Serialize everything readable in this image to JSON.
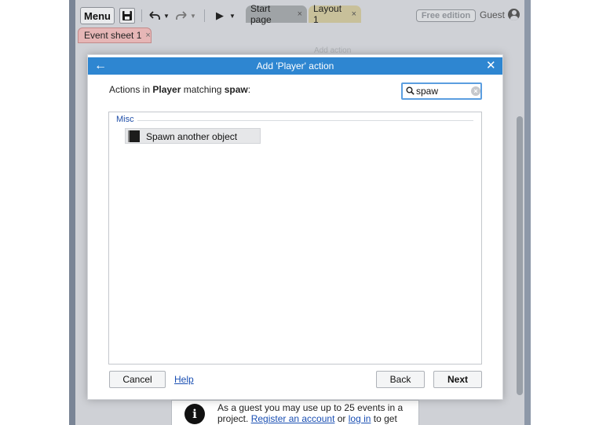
{
  "toolbar": {
    "menu_label": "Menu",
    "tabs": [
      {
        "label": "Start page",
        "close": "×"
      },
      {
        "label": "Layout 1",
        "close": "×"
      }
    ],
    "free_edition_label": "Free edition",
    "guest_label": "Guest"
  },
  "sheet_tab": {
    "label": "Event sheet 1",
    "close": "×"
  },
  "background": {
    "faded_text": "Add action"
  },
  "dialog": {
    "title": "Add 'Player' action",
    "back_glyph": "←",
    "close_glyph": "✕",
    "heading": {
      "prefix": "Actions in ",
      "object": "Player",
      "middle": " matching ",
      "query": "spaw",
      "suffix": ":"
    },
    "search": {
      "value": "spaw",
      "placeholder": "",
      "clear_glyph": "×"
    },
    "groups": [
      {
        "label": "Misc",
        "items": [
          {
            "label": "Spawn another object"
          }
        ]
      }
    ],
    "buttons": {
      "cancel": "Cancel",
      "help": "Help",
      "back": "Back",
      "next": "Next"
    }
  },
  "guest_notice": {
    "icon_glyph": "i",
    "line1": "As a guest you may use up to 25 events in a",
    "line2_prefix": "project. ",
    "register_link": "Register an account",
    "line2_middle": " or ",
    "login_link": "log in",
    "line2_suffix": " to get"
  },
  "colors": {
    "title_bar": "#2e86d1",
    "link": "#1a4fb3",
    "group_label": "#1f4ea8",
    "search_focus": "#5b9ee0"
  }
}
